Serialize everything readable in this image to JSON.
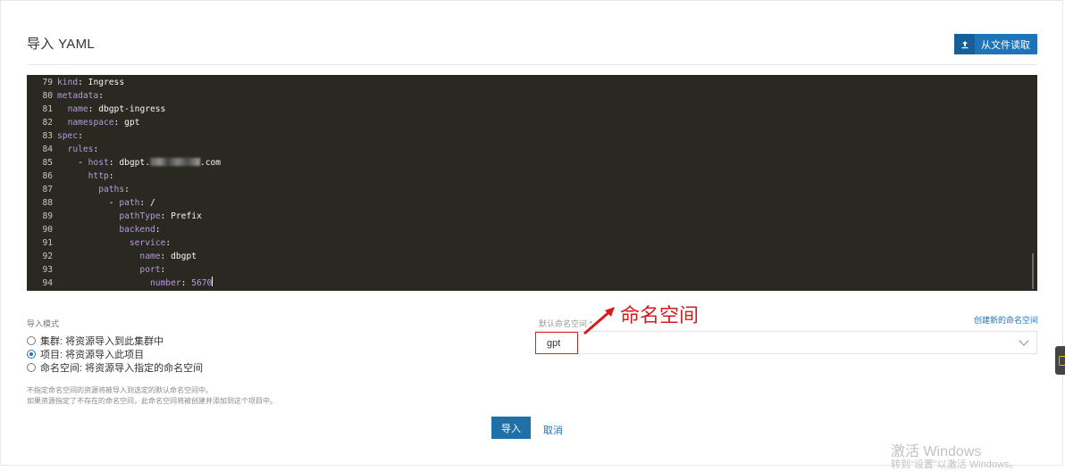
{
  "page": {
    "title": "导入 YAML"
  },
  "toolbar": {
    "read_file_label": "从文件读取",
    "upload_icon": "upload-icon"
  },
  "editor": {
    "lines": [
      {
        "num": "79",
        "indent": "",
        "key": "kind",
        "value": "Ingress"
      },
      {
        "num": "80",
        "indent": "",
        "key": "metadata",
        "value": ""
      },
      {
        "num": "81",
        "indent": "  ",
        "key": "name",
        "value": "dbgpt-ingress"
      },
      {
        "num": "82",
        "indent": "  ",
        "key": "namespace",
        "value": "gpt"
      },
      {
        "num": "83",
        "indent": "",
        "key": "spec",
        "value": ""
      },
      {
        "num": "84",
        "indent": "  ",
        "key": "rules",
        "value": ""
      },
      {
        "num": "85",
        "indent": "    - ",
        "key": "host",
        "value": "dbgpt.",
        "blurred": true,
        "suffix": ".com"
      },
      {
        "num": "86",
        "indent": "      ",
        "key": "http",
        "value": ""
      },
      {
        "num": "87",
        "indent": "        ",
        "key": "paths",
        "value": ""
      },
      {
        "num": "88",
        "indent": "          - ",
        "key": "path",
        "value": "/"
      },
      {
        "num": "89",
        "indent": "            ",
        "key": "pathType",
        "value": "Prefix"
      },
      {
        "num": "90",
        "indent": "            ",
        "key": "backend",
        "value": ""
      },
      {
        "num": "91",
        "indent": "              ",
        "key": "service",
        "value": ""
      },
      {
        "num": "92",
        "indent": "                ",
        "key": "name",
        "value": "dbgpt"
      },
      {
        "num": "93",
        "indent": "                ",
        "key": "port",
        "value": ""
      },
      {
        "num": "94",
        "indent": "                  ",
        "key": "number",
        "value": "5670",
        "numeric": true,
        "cursor": true
      }
    ]
  },
  "import_mode": {
    "label": "导入模式",
    "options": [
      {
        "label": "集群: 将资源导入到此集群中",
        "selected": false
      },
      {
        "label": "项目: 将资源导入此项目",
        "selected": true
      },
      {
        "label": "命名空间: 将资源导入指定的命名空间",
        "selected": false
      }
    ],
    "help": [
      "不指定命名空间的资源将被导入到选定的默认命名空间中。",
      "如果资源指定了不存在的命名空间，此命名空间将被创建并添加到这个项目中。"
    ]
  },
  "namespace": {
    "label": "默认命名空间 *",
    "value": "gpt",
    "create_link": "创建新的命名空间",
    "annotation": "命名空间"
  },
  "actions": {
    "import_label": "导入",
    "cancel_label": "取消"
  },
  "watermark": {
    "line1": "激活 Windows",
    "line2": "转到\"设置\"以激活 Windows。"
  },
  "colors": {
    "accent": "#1f73b7",
    "editor_bg": "#292921",
    "annotation": "#d41c1c"
  }
}
